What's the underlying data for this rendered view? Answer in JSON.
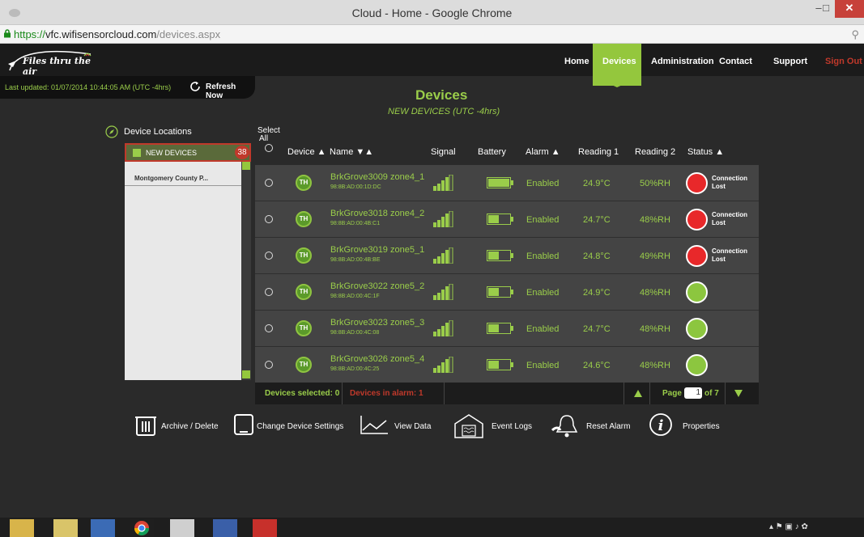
{
  "browser": {
    "title": "Cloud - Home - Google Chrome",
    "url_scheme": "https://",
    "url_host": "vfc.wifisensorcloud.com",
    "url_path": "/devices.aspx",
    "min_label": "–",
    "max_label": "□",
    "close_label": "✕",
    "zoom_label": "⚲"
  },
  "header": {
    "brand_text": "Files thru the air",
    "nav": [
      "Home",
      "Devices",
      "Administration",
      "Contact",
      "Support",
      "Sign Out"
    ],
    "active_nav": "Devices",
    "signout_color": "#c0392b"
  },
  "update": {
    "timestamp": "Last updated: 01/07/2014 10:44:05 AM (UTC -4hrs)",
    "refresh_label": "Refresh Now"
  },
  "page": {
    "title": "Devices",
    "subtitle": "NEW DEVICES  (UTC -4hrs)"
  },
  "locations": {
    "heading": "Device Locations",
    "new_devices_label": "NEW DEVICES",
    "new_devices_count": "38",
    "items": [
      "Montgomery County P..."
    ]
  },
  "table": {
    "select_all": [
      "Select",
      "All"
    ],
    "columns": [
      "Device ▲",
      "Name ▼▲",
      "Signal",
      "Battery",
      "Alarm ▲",
      "Reading 1",
      "Reading 2",
      "Status ▲"
    ],
    "rows": [
      {
        "type": "TH",
        "name": "BrkGrove3009 zone4_1",
        "mac": "98:8B:AD:00:1D:DC",
        "alarm": "Enabled",
        "reading1": "24.9°C",
        "reading2": "50%RH",
        "status": "lost",
        "status_text": [
          "Connection",
          "Lost"
        ],
        "battery_level": 1.0
      },
      {
        "type": "TH",
        "name": "BrkGrove3018 zone4_2",
        "mac": "98:8B:AD:00:4B:C1",
        "alarm": "Enabled",
        "reading1": "24.7°C",
        "reading2": "48%RH",
        "status": "lost",
        "status_text": [
          "Connection",
          "Lost"
        ],
        "battery_level": 0.5
      },
      {
        "type": "TH",
        "name": "BrkGrove3019 zone5_1",
        "mac": "98:8B:AD:00:4B:BE",
        "alarm": "Enabled",
        "reading1": "24.8°C",
        "reading2": "49%RH",
        "status": "lost",
        "status_text": [
          "Connection",
          "Lost"
        ],
        "battery_level": 0.5
      },
      {
        "type": "TH",
        "name": "BrkGrove3022 zone5_2",
        "mac": "98:8B:AD:00:4C:1F",
        "alarm": "Enabled",
        "reading1": "24.9°C",
        "reading2": "48%RH",
        "status": "ok",
        "status_text": [
          "",
          ""
        ],
        "battery_level": 0.5
      },
      {
        "type": "TH",
        "name": "BrkGrove3023 zone5_3",
        "mac": "98:8B:AD:00:4C:08",
        "alarm": "Enabled",
        "reading1": "24.7°C",
        "reading2": "48%RH",
        "status": "ok",
        "status_text": [
          "",
          ""
        ],
        "battery_level": 0.5
      },
      {
        "type": "TH",
        "name": "BrkGrove3026 zone5_4",
        "mac": "98:8B:AD:00:4C:25",
        "alarm": "Enabled",
        "reading1": "24.6°C",
        "reading2": "48%RH",
        "status": "ok",
        "status_text": [
          "",
          ""
        ],
        "battery_level": 0.5
      }
    ]
  },
  "footer": {
    "devices_selected": "Devices selected: 0",
    "devices_in_alarm": "Devices in alarm: 1",
    "page_label": "Page",
    "page_value": "1",
    "of_label": "of 7"
  },
  "actions": {
    "archive": "Archive / Delete",
    "change_settings": "Change Device Settings",
    "view_data": "View Data",
    "event_logs": "Event Logs",
    "reset_alarm": "Reset Alarm",
    "properties": "Properties"
  },
  "taskbar": {
    "icons": [
      "file-explorer-icon",
      "outlook-icon",
      "word-icon",
      "chrome-icon",
      "calculator-icon",
      "app-icon",
      "acrobat-icon"
    ]
  },
  "colors": {
    "accent": "#9acd4a",
    "active_nav_bg": "#94c73d",
    "alarm_red": "#e8282a",
    "ok_green": "#8cc63f"
  }
}
